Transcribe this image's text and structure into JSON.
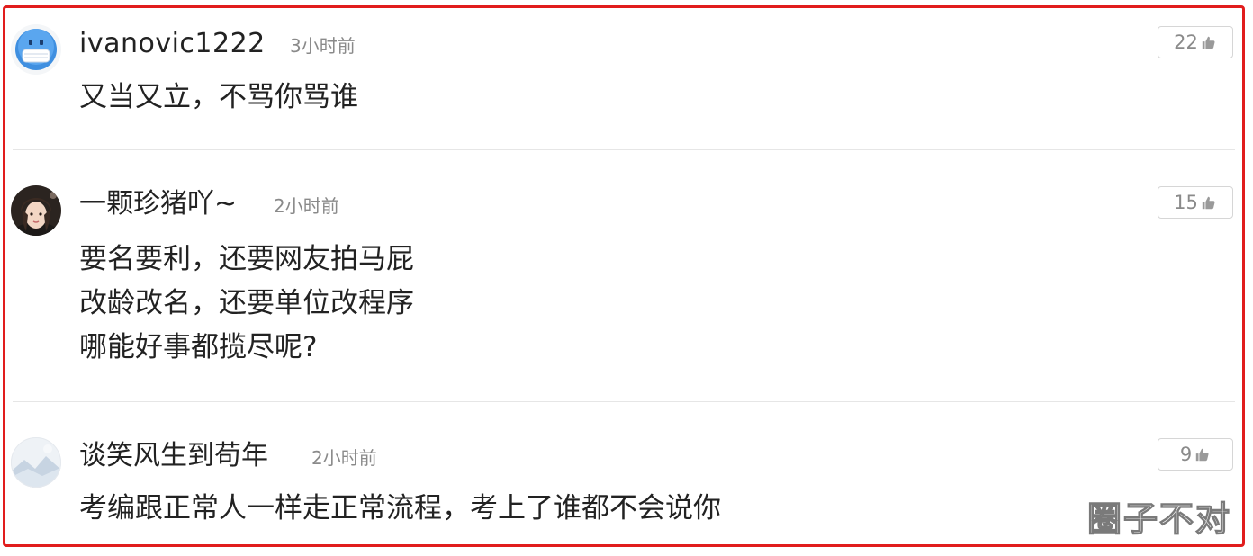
{
  "comments": [
    {
      "username": "ivanovic1222",
      "time": "3小时前",
      "likes": "22",
      "avatar_icon": "masked-face-emoji-icon",
      "lines": [
        "又当又立，不骂你骂谁"
      ]
    },
    {
      "username": "一颗珍猪吖~",
      "time": "2小时前",
      "likes": "15",
      "avatar_icon": "user-photo-avatar",
      "lines": [
        "要名要利，还要网友拍马屁",
        "改龄改名，还要单位改程序",
        "哪能好事都揽尽呢?"
      ]
    },
    {
      "username": "谈笑风生到苟年",
      "time": "2小时前",
      "likes": "9",
      "avatar_icon": "landscape-avatar-icon",
      "lines": [
        "考编跟正常人一样走正常流程，考上了谁都不会说你"
      ]
    }
  ],
  "watermark": "圈子不对",
  "colors": {
    "frame_border": "#e11d1d",
    "text_primary": "#222222",
    "text_secondary": "#8a8a8a"
  }
}
